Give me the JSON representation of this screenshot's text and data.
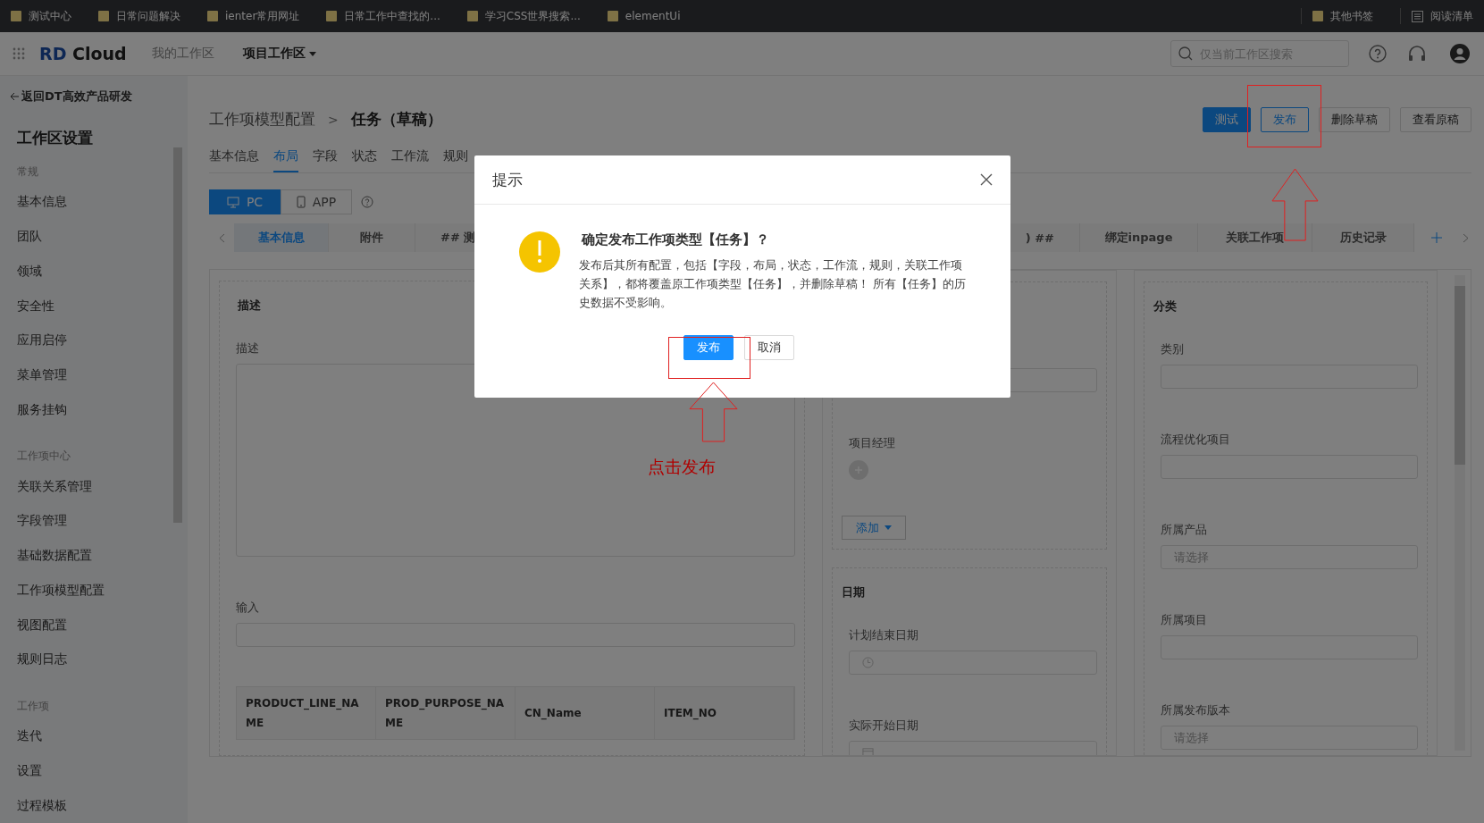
{
  "bookmarks": {
    "items": [
      {
        "label": "测试中心"
      },
      {
        "label": "日常问题解决"
      },
      {
        "label": "ienter常用网址"
      },
      {
        "label": "日常工作中查找的..."
      },
      {
        "label": "学习CSS世界搜索..."
      },
      {
        "label": "elementUi"
      }
    ],
    "right": [
      {
        "label": "其他书签",
        "kind": "folder"
      },
      {
        "label": "阅读清单",
        "kind": "list"
      }
    ]
  },
  "header": {
    "logo": {
      "mark": "RD",
      "name": "Cloud"
    },
    "nav": [
      {
        "label": "我的工作区",
        "selected": false,
        "dropdown": false
      },
      {
        "label": "项目工作区",
        "selected": true,
        "dropdown": true
      }
    ],
    "search": {
      "placeholder": "仅当前工作区搜索"
    }
  },
  "sidebar": {
    "back": "返回DT高效产品研发",
    "title": "工作区设置",
    "groups": [
      {
        "heading": "常规",
        "items": [
          {
            "label": "基本信息"
          },
          {
            "label": "团队"
          },
          {
            "label": "领域"
          },
          {
            "label": "安全性"
          },
          {
            "label": "应用启停"
          },
          {
            "label": "菜单管理"
          },
          {
            "label": "服务挂钩"
          }
        ]
      },
      {
        "heading": "工作项中心",
        "items": [
          {
            "label": "关联关系管理"
          },
          {
            "label": "字段管理"
          },
          {
            "label": "基础数据配置"
          },
          {
            "label": "工作项模型配置"
          },
          {
            "label": "视图配置"
          },
          {
            "label": "规则日志"
          }
        ]
      },
      {
        "heading": "工作项",
        "items": [
          {
            "label": "迭代"
          },
          {
            "label": "设置"
          },
          {
            "label": "过程模板"
          }
        ]
      }
    ]
  },
  "breadcrumb": {
    "parent": "工作项模型配置",
    "separator": ">",
    "current": "任务（草稿）"
  },
  "actions": [
    {
      "label": "测试",
      "kind": "primary"
    },
    {
      "label": "发布",
      "kind": "outline"
    },
    {
      "label": "删除草稿",
      "kind": "default"
    },
    {
      "label": "查看原稿",
      "kind": "default"
    }
  ],
  "tabs": [
    {
      "label": "基本信息",
      "selected": false
    },
    {
      "label": "布局",
      "selected": true
    },
    {
      "label": "字段",
      "selected": false
    },
    {
      "label": "状态",
      "selected": false
    },
    {
      "label": "工作流",
      "selected": false
    },
    {
      "label": "规则",
      "selected": false
    }
  ],
  "devices": [
    {
      "label": "PC",
      "kind": "desktop",
      "selected": true
    },
    {
      "label": "APP",
      "kind": "mobile",
      "selected": false
    }
  ],
  "layout_tabs": {
    "left": [
      {
        "label": "基本信息",
        "selected": true
      },
      {
        "label": "附件",
        "selected": false
      },
      {
        "label": "## 测",
        "selected": false
      }
    ],
    "right": [
      {
        "label": ") ##",
        "selected": false
      },
      {
        "label": "绑定inpage",
        "selected": false
      },
      {
        "label": "关联工作项",
        "selected": false
      },
      {
        "label": "历史记录",
        "selected": false
      }
    ]
  },
  "form": {
    "left": {
      "title": "描述",
      "fields": [
        {
          "label": "描述",
          "kind": "textarea"
        },
        {
          "label": "输入",
          "kind": "input"
        }
      ],
      "table": {
        "columns": [
          "PRODUCT_LINE_NAME",
          "PROD_PURPOSE_NAME",
          "CN_Name",
          "ITEM_NO"
        ]
      }
    },
    "middle": {
      "fields": [
        {
          "kind": "input"
        },
        {
          "label": "项目经理",
          "kind": "people"
        }
      ],
      "add_button": "添加",
      "date_section": {
        "title": "日期",
        "fields": [
          {
            "label": "计划结束日期",
            "kind": "time"
          },
          {
            "label": "实际开始日期",
            "kind": "date"
          }
        ]
      }
    },
    "right": {
      "title": "分类",
      "fields": [
        {
          "label": "类别",
          "kind": "input"
        },
        {
          "label": "流程优化项目",
          "kind": "input"
        },
        {
          "label": "所属产品",
          "kind": "select",
          "placeholder": "请选择"
        },
        {
          "label": "所属项目",
          "kind": "input"
        },
        {
          "label": "所属发布版本",
          "kind": "select",
          "placeholder": "请选择"
        }
      ]
    }
  },
  "dialog": {
    "title": "提示",
    "heading": "确定发布工作项类型【任务】？",
    "message": "发布后其所有配置，包括【字段，布局，状态，工作流，规则，关联工作项关系】，都将覆盖原工作项类型【任务】，并删除草稿！ 所有【任务】的历史数据不受影响。",
    "buttons": [
      {
        "label": "发布",
        "kind": "primary"
      },
      {
        "label": "取消",
        "kind": "default"
      }
    ]
  },
  "annotation": {
    "callout": "点击发布"
  }
}
